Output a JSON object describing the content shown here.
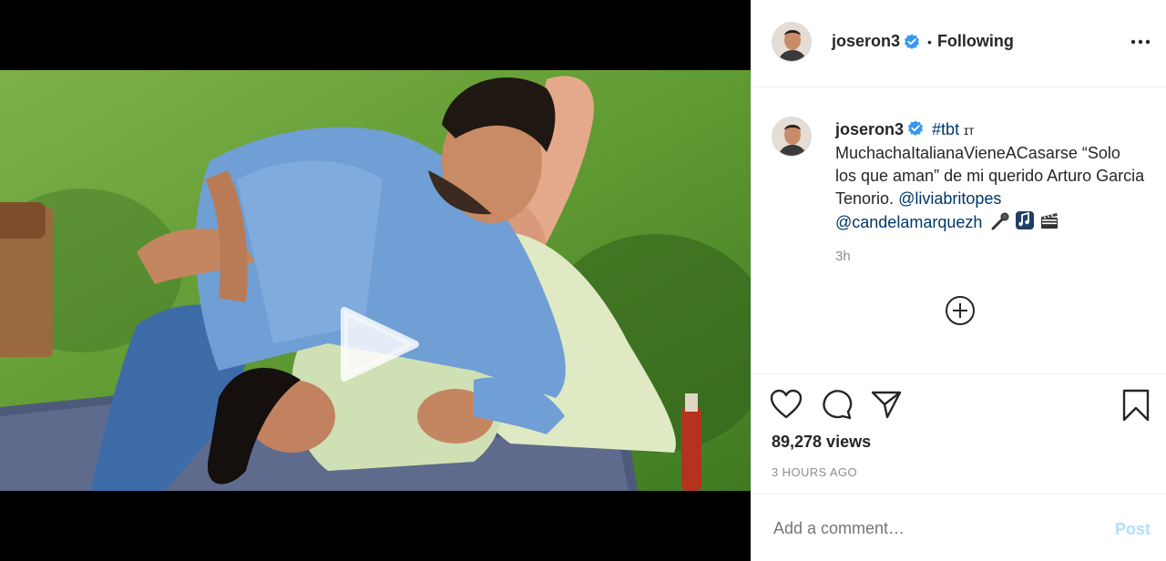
{
  "header": {
    "username": "joseron3",
    "separator": "•",
    "follow_status": "Following"
  },
  "caption": {
    "username": "joseron3",
    "hashtag": "#tbt",
    "tag_glyph": "ɪᴛ",
    "text": "MuchachaItalianaVieneACasarse “Solo los que aman” de mi querido Arturo Garcia Tenorio.",
    "mention1": "@liviabritopes",
    "mention2": "@candelamarquezh",
    "emojis": [
      "microphone-emoji",
      "music-emoji",
      "clapper-emoji"
    ],
    "time": "3h"
  },
  "stats": {
    "views": "89,278 views",
    "posted": "3 HOURS AGO"
  },
  "comment_box": {
    "placeholder": "Add a comment…",
    "post_label": "Post"
  },
  "icons": {
    "verified": "verified-badge-icon",
    "more": "more-options-icon",
    "like": "heart-icon",
    "comment": "comment-icon",
    "share": "share-icon",
    "save": "bookmark-icon",
    "load_more": "plus-circle-icon",
    "play": "play-icon",
    "audio": "volume-icon"
  },
  "colors": {
    "verified_blue": "#3897f0",
    "link_blue": "#00376b",
    "post_disabled": "#b2dffc",
    "muted_text": "#8e8e8e"
  }
}
